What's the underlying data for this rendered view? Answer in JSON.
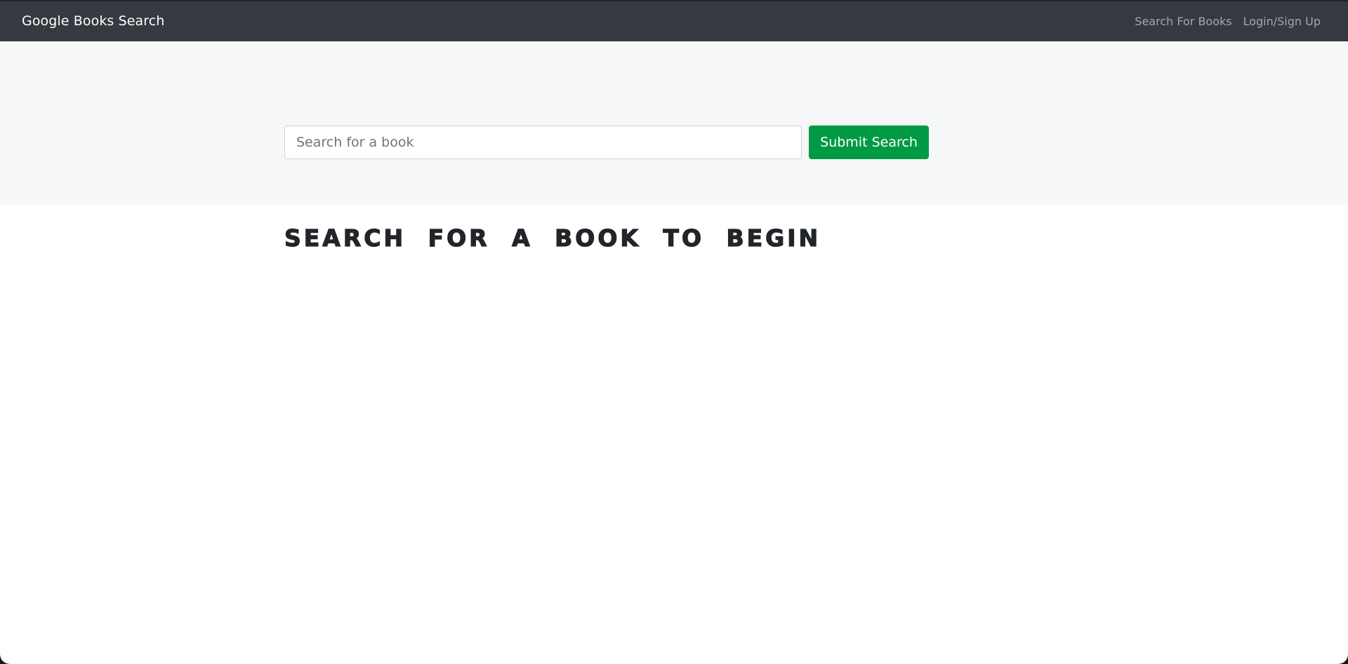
{
  "navbar": {
    "brand": "Google Books Search",
    "links": [
      {
        "label": "Search For Books"
      },
      {
        "label": "Login/Sign Up"
      }
    ]
  },
  "search": {
    "placeholder": "Search for a book",
    "value": "",
    "submit_label": "Submit Search"
  },
  "main": {
    "heading": "Search for a book to begin"
  },
  "colors": {
    "navbar_bg": "#343a40",
    "jumbotron_bg": "#f6f7f9",
    "submit_button": "#009a44",
    "heading_text": "#212529"
  }
}
